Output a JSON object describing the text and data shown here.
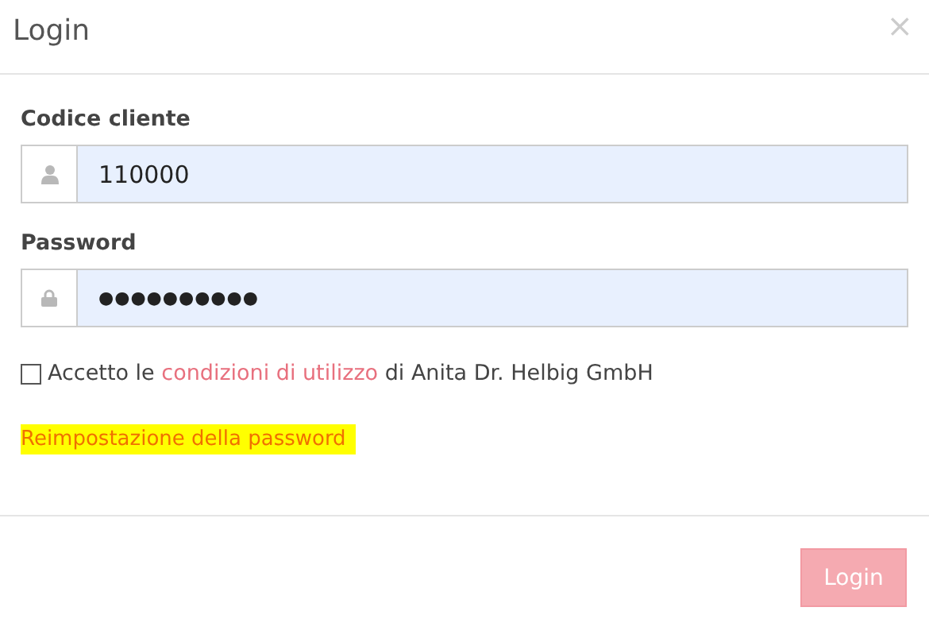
{
  "dialog": {
    "title": "Login",
    "close": "×"
  },
  "fields": [
    {
      "label": "Codice cliente",
      "kind": "user",
      "value": "110000"
    },
    {
      "label": "Password",
      "kind": "lock",
      "value": "●●●●●●●●●●"
    }
  ],
  "terms": {
    "checked": false,
    "before": "Accetto le",
    "link": "condizioni di utilizzo",
    "after": "di Anita Dr. Helbig GmbH"
  },
  "reset_link": {
    "label": "Reimpostazione della password",
    "highlighted": true
  },
  "footer": {
    "button": {
      "label": "Login",
      "disabled": true
    }
  }
}
